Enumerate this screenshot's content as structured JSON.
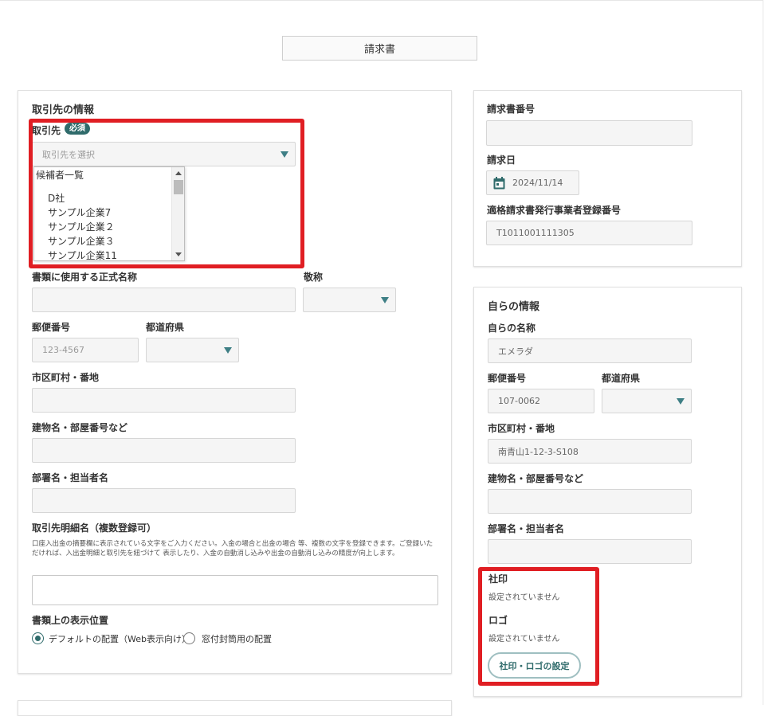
{
  "document_type": "請求書",
  "client_section": {
    "title": "取引先の情報",
    "client_label": "取引先",
    "required_badge": "必須",
    "client_select_placeholder": "取引先を選択",
    "dropdown": {
      "group_header": "候補者一覧",
      "options": [
        "D社",
        "サンプル企業7",
        "サンプル企業２",
        "サンプル企業３",
        "サンプル企業11"
      ]
    },
    "official_name_label": "書類に使用する正式名称",
    "honorific_label": "敬称",
    "postal_label": "郵便番号",
    "postal_placeholder": "123-4567",
    "prefecture_label": "都道府県",
    "city_label": "市区町村・番地",
    "building_label": "建物名・部屋番号など",
    "department_label": "部署名・担当者名",
    "detail_name_label": "取引先明細名（複数登録可）",
    "detail_help": "口座入出金の摘要欄に表示されている文字をご入力ください。入金の場合と出金の場合 等、複数の文字を登録できます。ご登録いただければ、入出金明細と取引先を紐づけて 表示したり、入金の自動消し込みや出金の自動消し込みの精度が向上します。",
    "display_position_label": "書類上の表示位置",
    "radio_default": "デフォルトの配置（Web表示向け）",
    "radio_window": "窓付封筒用の配置"
  },
  "invoice_section": {
    "invoice_number_label": "請求書番号",
    "invoice_date_label": "請求日",
    "invoice_date_value": "2024/11/14",
    "registration_label": "適格請求書発行事業者登録番号",
    "registration_value": "T1011001111305"
  },
  "own_section": {
    "title": "自らの情報",
    "name_label": "自らの名称",
    "name_value": "エメラダ",
    "postal_label": "郵便番号",
    "postal_value": "107-0062",
    "prefecture_label": "都道府県",
    "city_label": "市区町村・番地",
    "city_value": "南青山1-12-3-S108",
    "building_label": "建物名・部屋番号など",
    "department_label": "部署名・担当者名",
    "seal_label": "社印",
    "seal_status": "設定されていません",
    "logo_label": "ロゴ",
    "logo_status": "設定されていません",
    "seal_logo_button": "社印・ロゴの設定"
  },
  "colors": {
    "accent": "#2f6b6b",
    "caret": "#3e7f85",
    "highlight": "#e01e23"
  }
}
